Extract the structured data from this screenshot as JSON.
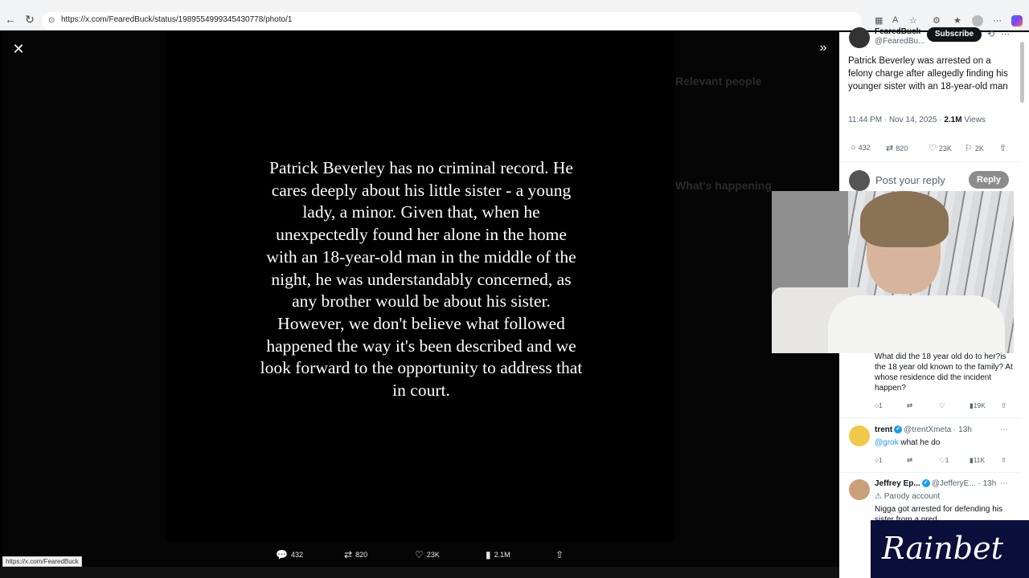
{
  "browser": {
    "url": "https://x.com/FearedBuck/status/1989554999345430778/photo/1",
    "status_url": "https://x.com/FearedBuck"
  },
  "viewer": {
    "quote": "Patrick Beverley has no criminal record. He cares deeply about his little sister - a young lady, a minor. Given that, when he unexpectedly found her alone in the home with an 18-year-old man in the middle of the night, he was understandably concerned, as any brother would be about his sister. However, we don't believe what followed happened the way it's been described and we look forward to the opportunity to address that in court.",
    "bg_labels": {
      "relevant": "Relevant people",
      "happening": "What's happening"
    },
    "actions": {
      "replies": "432",
      "reposts": "820",
      "likes": "23K",
      "views": "2.1M"
    }
  },
  "post": {
    "author_name": "FearedBuck",
    "author_handle": "@FearedBu...",
    "subscribe_label": "Subscribe",
    "text": "Patrick Beverley was arrested on a felony charge after allegedly finding his younger sister with an 18-year-old man",
    "time": "11:44 PM · Nov 14, 2025 ·",
    "views_count": "2.1M",
    "views_label": "Views",
    "stats": {
      "replies": "432",
      "reposts": "820",
      "likes": "23K",
      "bookmarks": "2K"
    },
    "reply_placeholder": "Post your reply",
    "reply_button": "Reply"
  },
  "replies": [
    {
      "text": "What did the 18 year old do to her?is the 18 year old known to the family? At whose residence did the incident happen?",
      "replies": "1",
      "likes": "",
      "views": "19K"
    },
    {
      "name": "trent",
      "handle": "@trentXmeta · 13h",
      "mention": "@grok",
      "text": " what he do",
      "replies": "1",
      "likes": "1",
      "views": "11K"
    },
    {
      "name": "Jeffrey Ep...",
      "handle": "@JefferyE... · 13h",
      "badge": "Parody account",
      "text": "Nigga got arrested for defending his sister from a pred"
    }
  ],
  "overlay": {
    "brand": "Rainbet"
  },
  "colors": {
    "accent": "#1d9bf0",
    "brand_bg": "#0a0e3a"
  }
}
